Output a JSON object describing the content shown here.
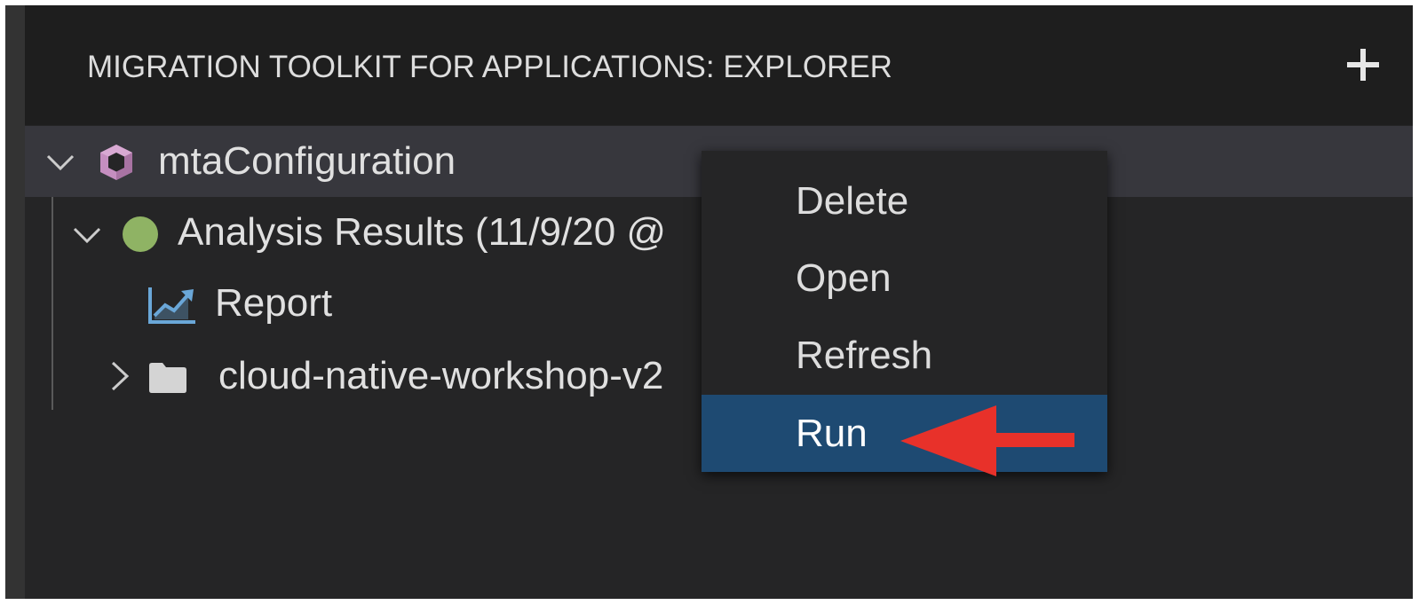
{
  "panel": {
    "title": "MIGRATION TOOLKIT FOR APPLICATIONS: EXPLORER",
    "add_icon": "plus-icon"
  },
  "tree": {
    "config": {
      "label": "mtaConfiguration",
      "icon": "cube-icon",
      "expanded": true
    },
    "analysis": {
      "label": "Analysis Results (11/9/20 @",
      "icon": "status-dot-icon",
      "expanded": true
    },
    "report": {
      "label": "Report",
      "icon": "chart-icon"
    },
    "folder": {
      "label": "cloud-native-workshop-v2",
      "icon": "folder-icon",
      "expanded": false
    }
  },
  "context_menu": {
    "items": [
      {
        "label": "Delete"
      },
      {
        "label": "Open"
      },
      {
        "label": "Refresh"
      },
      {
        "label": "Run"
      }
    ],
    "active_index": 3
  },
  "colors": {
    "accent_highlight": "#1e4a72",
    "annotation_arrow": "#e8312a",
    "status_dot": "#8fb364",
    "cube_icon": "#c58ec0"
  }
}
